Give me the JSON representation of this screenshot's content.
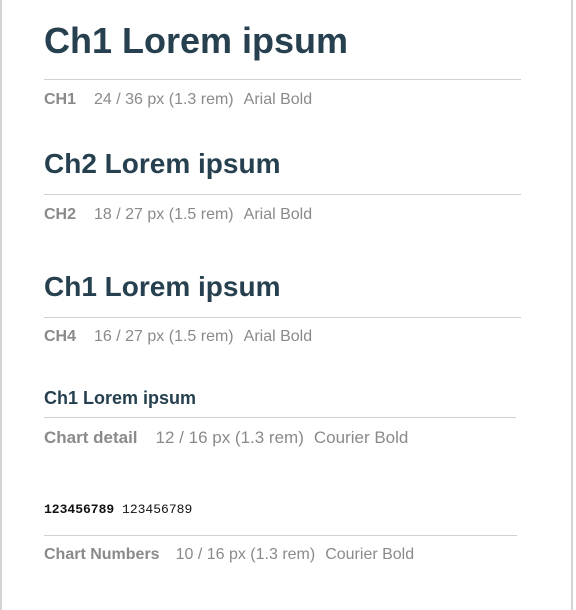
{
  "rows": [
    {
      "sample": "Ch1 Lorem ipsum",
      "tag": "CH1",
      "size": "24 / 36 px (1.3 rem)",
      "font": "Arial Bold"
    },
    {
      "sample": "Ch2 Lorem ipsum",
      "tag": "CH2",
      "size": "18 / 27 px (1.5 rem)",
      "font": "Arial Bold"
    },
    {
      "sample": "Ch1 Lorem ipsum",
      "tag": "CH4",
      "size": "16 / 27 px (1.5 rem)",
      "font": "Arial Bold"
    },
    {
      "sample": "Ch1 Lorem ipsum",
      "tag": "Chart detail",
      "size": "12 / 16 px (1.3 rem)",
      "font": "Courier Bold"
    }
  ],
  "numbers": {
    "bold": "123456789",
    "regular": "123456789",
    "tag": "Chart Numbers",
    "size": "10 / 16 px (1.3 rem)",
    "font": "Courier Bold"
  },
  "colors": {
    "heading": "#26404f",
    "spec_text": "#8a8a8a",
    "rule": "#d0d0d0"
  }
}
